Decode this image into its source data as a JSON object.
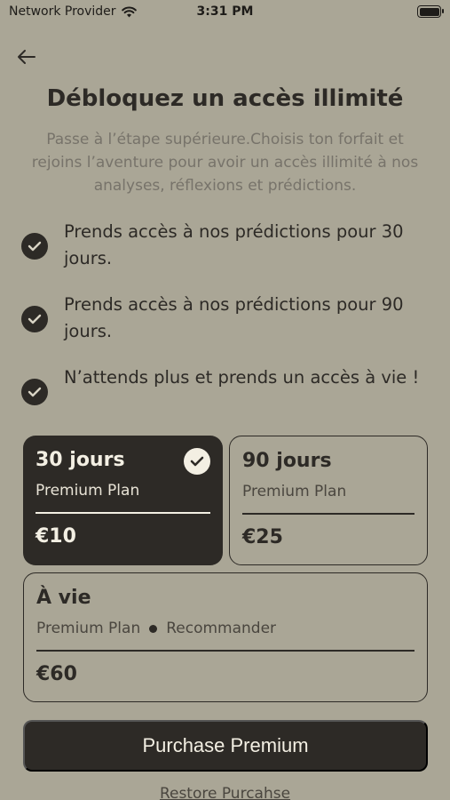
{
  "status_bar": {
    "carrier": "Network Provider",
    "time": "3:31 PM"
  },
  "header": {
    "title": "Débloquez un accès illimité",
    "subtitle": "Passe à l’étape supérieure.Choisis ton forfait et rejoins l’aventure pour avoir un accès illimité à nos analyses, réflexions et prédictions."
  },
  "features": [
    {
      "text": "Prends accès à nos prédictions pour 30 jours."
    },
    {
      "text": "Prends accès à nos prédictions pour 90 jours."
    },
    {
      "text": "N’attends plus et prends un accès à vie !"
    }
  ],
  "plans": [
    {
      "name": "30 jours",
      "subtitle": "Premium Plan",
      "price": "€10",
      "selected": true
    },
    {
      "name": "90 jours",
      "subtitle": "Premium Plan",
      "price": "€25",
      "selected": false
    },
    {
      "name": "À vie",
      "subtitle": "Premium Plan",
      "badge": "Recommander",
      "price": "€60",
      "selected": false
    }
  ],
  "actions": {
    "purchase_label": "Purchase Premium",
    "restore_label": "Restore Purcahse"
  },
  "colors": {
    "background": "#aaa696",
    "primary_dark": "#2d2a26",
    "light_text": "#f3efe3",
    "muted_text": "#77736a"
  },
  "icons": [
    "wifi-icon",
    "battery-icon",
    "back-arrow-icon",
    "check-icon"
  ]
}
